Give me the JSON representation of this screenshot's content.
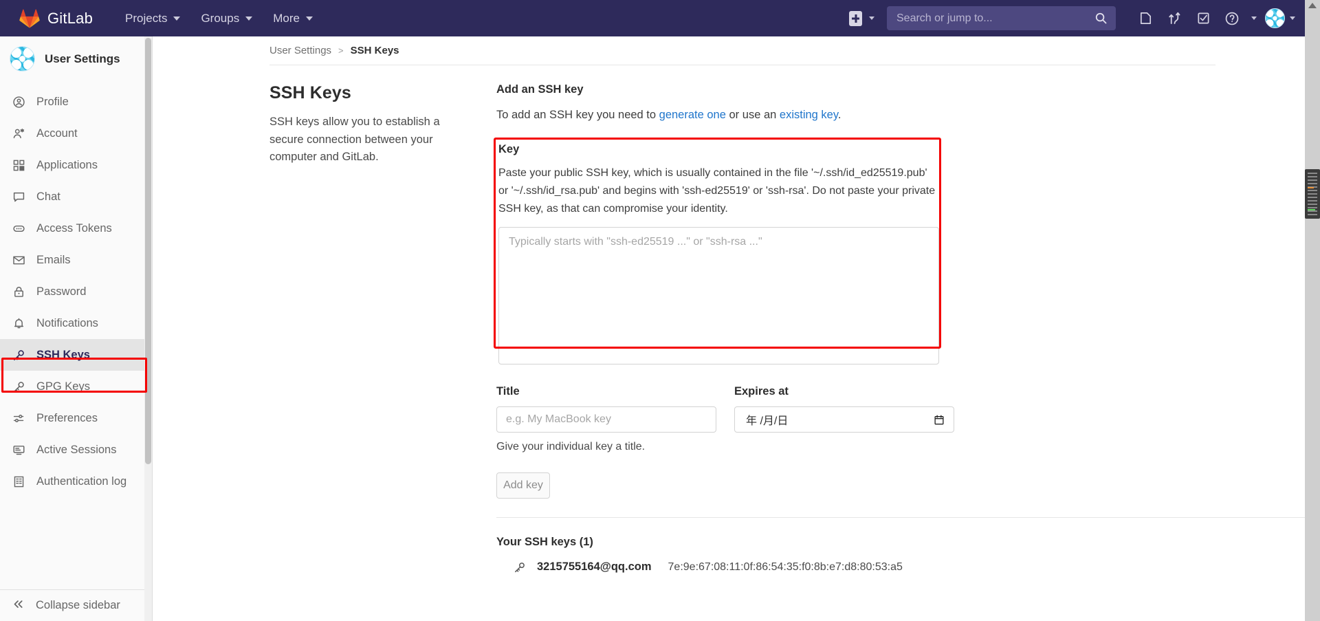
{
  "topnav": {
    "brand": "GitLab",
    "items": [
      {
        "label": "Projects"
      },
      {
        "label": "Groups"
      },
      {
        "label": "More"
      }
    ],
    "create_new_label": "plus-icon",
    "search": {
      "placeholder": "Search or jump to..."
    },
    "icons": [
      {
        "name": "issues-icon"
      },
      {
        "name": "merge-requests-icon"
      },
      {
        "name": "todos-icon"
      },
      {
        "name": "help-icon"
      }
    ],
    "colors": {
      "bar": "#2e2a5b",
      "search_bg": "#4d4880"
    }
  },
  "sidebar": {
    "title": "User Settings",
    "items": [
      {
        "label": "Profile",
        "icon": "profile-icon",
        "active": false
      },
      {
        "label": "Account",
        "icon": "account-icon",
        "active": false
      },
      {
        "label": "Applications",
        "icon": "applications-icon",
        "active": false
      },
      {
        "label": "Chat",
        "icon": "chat-icon",
        "active": false
      },
      {
        "label": "Access Tokens",
        "icon": "access-tokens-icon",
        "active": false
      },
      {
        "label": "Emails",
        "icon": "emails-icon",
        "active": false
      },
      {
        "label": "Password",
        "icon": "password-lock-icon",
        "active": false
      },
      {
        "label": "Notifications",
        "icon": "notifications-bell-icon",
        "active": false
      },
      {
        "label": "SSH Keys",
        "icon": "ssh-key-icon",
        "active": true
      },
      {
        "label": "GPG Keys",
        "icon": "gpg-key-icon",
        "active": false
      },
      {
        "label": "Preferences",
        "icon": "preferences-icon",
        "active": false
      },
      {
        "label": "Active Sessions",
        "icon": "active-sessions-icon",
        "active": false
      },
      {
        "label": "Authentication log",
        "icon": "authentication-log-icon",
        "active": false
      }
    ],
    "collapse": {
      "label": "Collapse sidebar",
      "icon": "double-chevron-left-icon"
    }
  },
  "breadcrumb": {
    "root": "User Settings",
    "separator": ">",
    "current": "SSH Keys"
  },
  "page": {
    "section_title": "SSH Keys",
    "section_desc": "SSH keys allow you to establish a secure connection between your computer and GitLab."
  },
  "form": {
    "title": "Add an SSH key",
    "sub_prefix": "To add an SSH key you need to ",
    "link_generate": "generate one",
    "sub_middle": " or use an ",
    "link_existing": "existing key",
    "sub_suffix": ".",
    "key_label": "Key",
    "key_help": "Paste your public SSH key, which is usually contained in the file '~/.ssh/id_ed25519.pub' or '~/.ssh/id_rsa.pub' and begins with 'ssh-ed25519' or 'ssh-rsa'. Do not paste your private SSH key, as that can compromise your identity.",
    "key_placeholder": "Typically starts with \"ssh-ed25519 ...\" or \"ssh-rsa ...\"",
    "key_value": "",
    "title_label": "Title",
    "title_placeholder": "e.g. My MacBook key",
    "title_value": "",
    "title_help": "Give your individual key a title.",
    "expires_label": "Expires at",
    "expires_placeholder": "年 /月/日",
    "expires_value": "",
    "calendar_icon": "calendar-icon",
    "submit_label": "Add key"
  },
  "keys_list": {
    "heading": "Your SSH keys (1)",
    "rows": [
      {
        "title": "3215755164@qq.com",
        "fingerprint": "7e:9e:67:08:11:0f:86:54:35:f0:8b:e7:d8:80:53:a5",
        "icon": "ssh-key-icon"
      }
    ]
  },
  "annotations": {
    "highlight_color": "#f40000",
    "targets": [
      "sidebar-item-ssh-keys",
      "key-field-block"
    ]
  }
}
